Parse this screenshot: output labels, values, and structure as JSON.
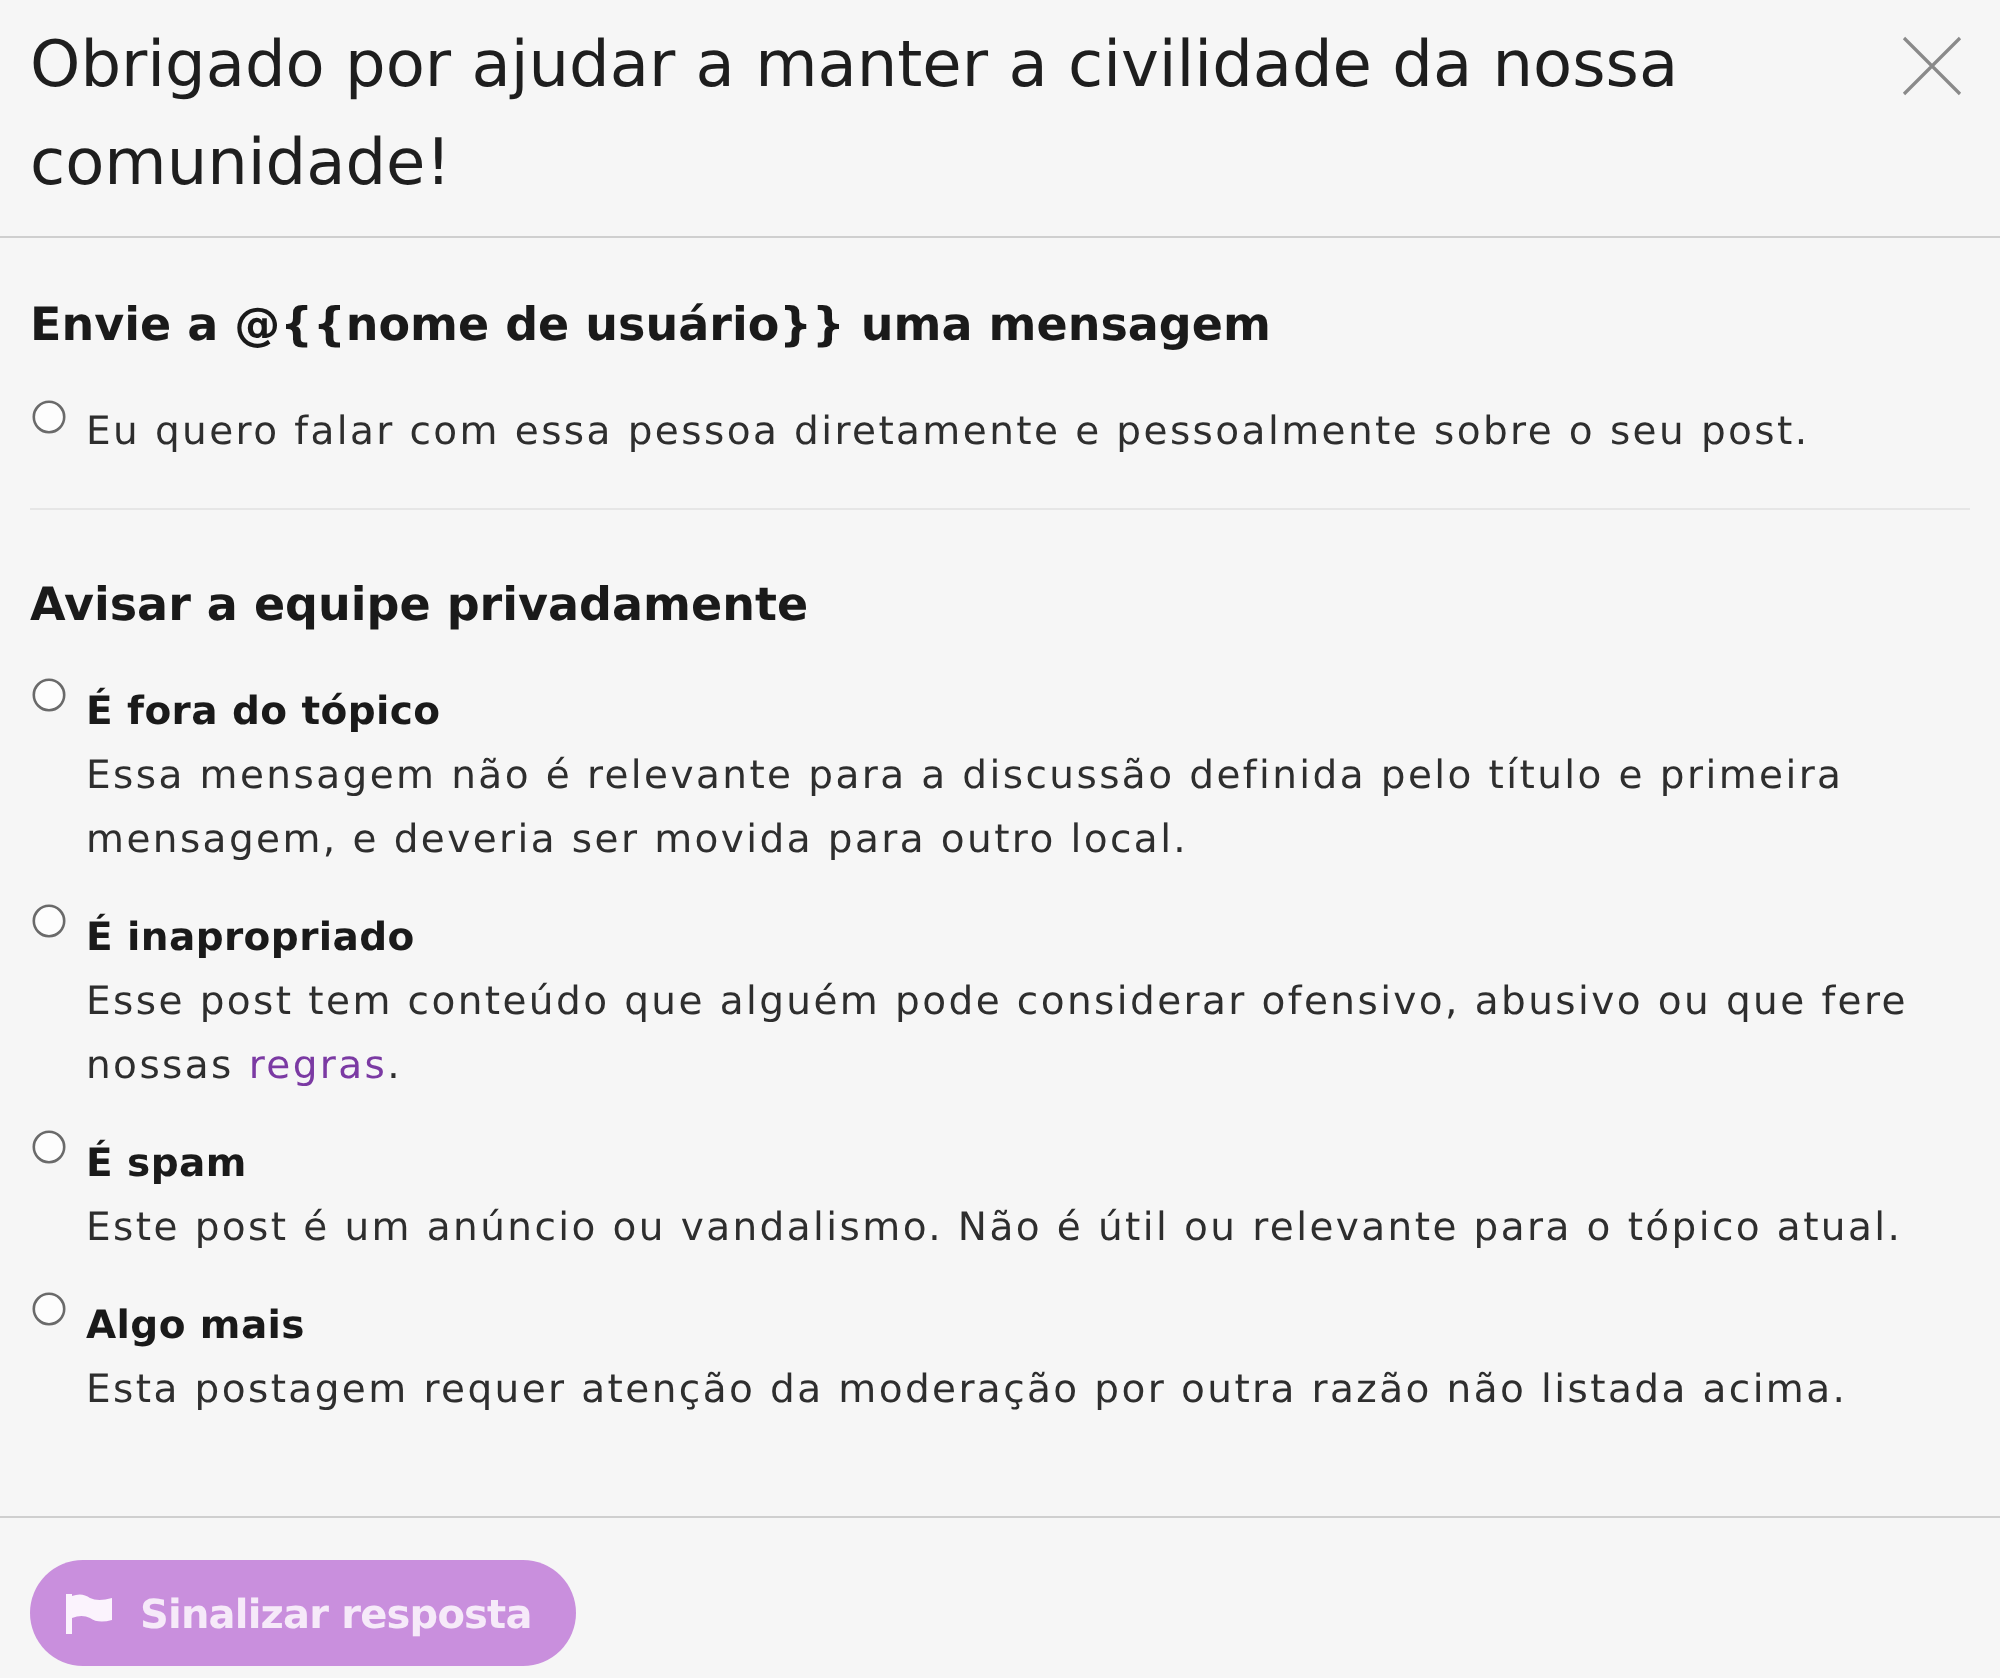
{
  "dialog": {
    "title": "Obrigado por ajudar a manter a civilidade da nossa comunidade!"
  },
  "sections": [
    {
      "heading": "Envie a @{{nome de usuário}} uma mensagem",
      "options": [
        {
          "kind": "plain",
          "label": "Eu quero falar com essa pessoa diretamente e pessoalmente sobre o seu post.",
          "selected": false
        }
      ]
    },
    {
      "heading": "Avisar a equipe privadamente",
      "options": [
        {
          "kind": "titled",
          "title": "É fora do tópico",
          "description": [
            {
              "kind": "text",
              "text": "Essa mensagem não é relevante para a discussão definida pelo título e primeira mensagem, e deveria ser movida para outro local."
            }
          ],
          "selected": false
        },
        {
          "kind": "titled",
          "title": "É inapropriado",
          "description": [
            {
              "kind": "text",
              "text": "Esse post tem conteúdo que alguém pode considerar ofensivo, abusivo ou que fere nossas "
            },
            {
              "kind": "link",
              "text": "regras"
            },
            {
              "kind": "text",
              "text": "."
            }
          ],
          "selected": false
        },
        {
          "kind": "titled",
          "title": "É spam",
          "description": [
            {
              "kind": "text",
              "text": "Este post é um anúncio ou vandalismo. Não é útil ou relevante para o tópico atual."
            }
          ],
          "selected": false
        },
        {
          "kind": "titled",
          "title": "Algo mais",
          "description": [
            {
              "kind": "text",
              "text": "Esta postagem requer atenção da moderação por outra razão não listada acima."
            }
          ],
          "selected": false
        }
      ]
    }
  ],
  "footer": {
    "button": {
      "label": "Sinalizar resposta",
      "disabled": true
    }
  }
}
